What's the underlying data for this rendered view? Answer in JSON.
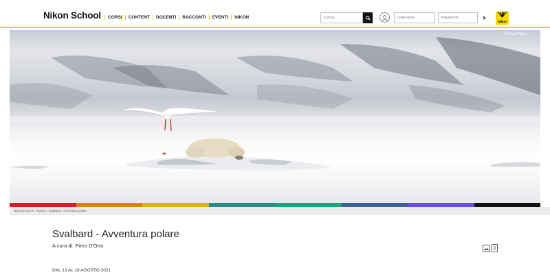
{
  "header": {
    "logo": "Nikon School",
    "nav": [
      "CORSI",
      "CONTENT",
      "DOCENTI",
      "RACCONTI",
      "EVENTI",
      "NIKON"
    ],
    "search_placeholder": "Cerca...",
    "username_placeholder": "Username",
    "password_placeholder": "Password",
    "brand_badge": "Nikon",
    "accent_color": "#f2d200"
  },
  "hero": {
    "photo_credit": "© Piero D'Orto",
    "color_bar": [
      "#d32027",
      "#d8811d",
      "#d9b51d",
      "#2e8a86",
      "#1ea27a",
      "#3f5f93",
      "#6b4fd8",
      "#111111"
    ]
  },
  "breadcrumb": "Nikonschool.it > Travel > Svalbard - Avventura polare",
  "article": {
    "title": "Svalbard - Avventura polare",
    "author": "A cura di: Piero D'Orto",
    "date": "DAL 13 AL 18 AGOSTO 2021"
  }
}
